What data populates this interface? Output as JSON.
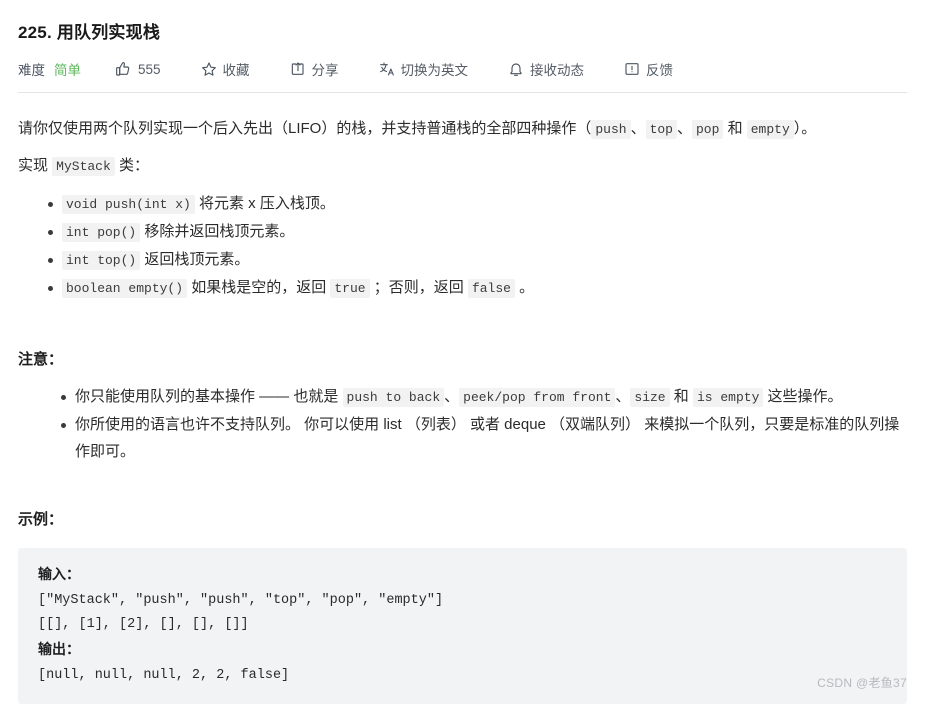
{
  "header": {
    "title_number": "225.",
    "title_text": " 用队列实现栈",
    "difficulty_label": "难度",
    "difficulty_value": "简单",
    "like_count": "555",
    "favorite_label": "收藏",
    "share_label": "分享",
    "translate_label": "切换为英文",
    "subscribe_label": "接收动态",
    "feedback_label": "反馈",
    "icons": {
      "like": "thumbs-up-icon",
      "favorite": "star-icon",
      "share": "share-icon",
      "translate": "translate-icon",
      "subscribe": "bell-icon",
      "feedback": "feedback-icon"
    },
    "colors": {
      "difficulty_easy": "#5bb75b",
      "text": "#555c66",
      "divider": "#e3e3e5"
    }
  },
  "description": {
    "p1_a": "请你仅使用两个队列实现一个后入先出（LIFO）的栈，并支持普通栈的全部四种操作（",
    "p1_code1": "push",
    "p1_b": "、",
    "p1_code2": "top",
    "p1_c": "、",
    "p1_code3": "pop",
    "p1_d": " 和 ",
    "p1_code4": "empty",
    "p1_e": "）。",
    "p2_a": "实现 ",
    "p2_code": "MyStack",
    "p2_b": " 类："
  },
  "api_list": [
    {
      "code": "void push(int x)",
      "text": " 将元素 x 压入栈顶。"
    },
    {
      "code": "int pop()",
      "text": " 移除并返回栈顶元素。"
    },
    {
      "code": "int top()",
      "text": " 返回栈顶元素。"
    },
    {
      "code": "boolean empty()",
      "text": " 如果栈是空的，返回 ",
      "code2": "true",
      "text2": " ；否则，返回 ",
      "code3": "false",
      "text3": " 。"
    }
  ],
  "notes": {
    "heading": "注意：",
    "item1": {
      "a": "你只能使用队列的基本操作 —— 也就是 ",
      "code1": "push to back",
      "b": "、",
      "code2": "peek/pop from front",
      "c": "、",
      "code3": "size",
      "d": " 和 ",
      "code4": "is empty",
      "e": " 这些操作。"
    },
    "item2": "你所使用的语言也许不支持队列。 你可以使用 list （列表） 或者 deque （双端队列） 来模拟一个队列，只要是标准的队列操作即可。"
  },
  "example": {
    "heading": "示例：",
    "input_label": "输入：",
    "input_line1": "[\"MyStack\", \"push\", \"push\", \"top\", \"pop\", \"empty\"]",
    "input_line2": "[[], [1], [2], [], [], []]",
    "output_label": "输出：",
    "output_line1": "[null, null, null, 2, 2, false]"
  },
  "watermark": "CSDN @老鱼37"
}
